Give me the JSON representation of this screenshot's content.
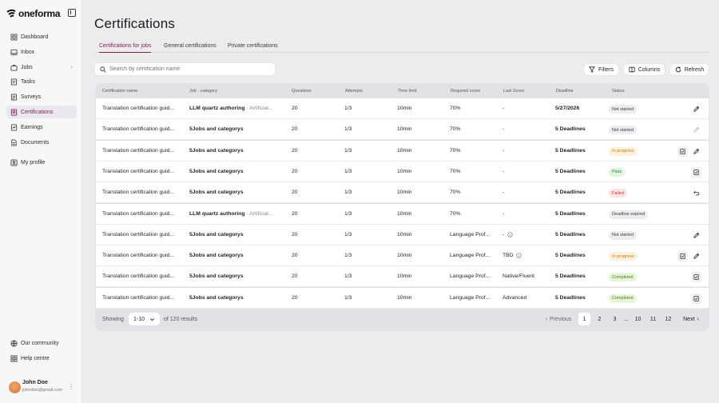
{
  "brand": {
    "name": "oneforma"
  },
  "sidebar": {
    "items": [
      {
        "label": "Dashboard",
        "icon": "grid-icon"
      },
      {
        "label": "Inbox",
        "icon": "inbox-icon"
      },
      {
        "label": "Jobs",
        "icon": "briefcase-icon"
      },
      {
        "label": "Tasks",
        "icon": "tasks-icon"
      },
      {
        "label": "Surveys",
        "icon": "survey-icon"
      },
      {
        "label": "Certifications",
        "icon": "certificate-icon",
        "active": true
      },
      {
        "label": "Earnings",
        "icon": "earnings-icon"
      },
      {
        "label": "Documents",
        "icon": "document-icon"
      },
      {
        "label": "My profile",
        "icon": "profile-icon"
      }
    ],
    "footer": [
      {
        "label": "Our community",
        "icon": "globe-icon"
      },
      {
        "label": "Help centre",
        "icon": "help-icon"
      }
    ],
    "user": {
      "name": "John Doe",
      "email": "johndoe@gmail.com"
    }
  },
  "page": {
    "title": "Certifications"
  },
  "tabs": [
    "Certifications for jobs",
    "General certifications",
    "Private certifications"
  ],
  "search": {
    "placeholder": "Search by certification name"
  },
  "toolbar": {
    "filters": "Filters",
    "columns": "Columns",
    "refresh": "Refresh"
  },
  "table": {
    "headers": [
      "Certification name",
      "Job · category",
      "Questions",
      "Attempts",
      "Time limit",
      "Required score",
      "Last Score",
      "Deadline",
      "Status"
    ],
    "rows": [
      {
        "name": "Translation certification guid...",
        "job": "LLM quartz authoring",
        "category": "· Artificial...",
        "questions": "20",
        "attempts": "1/3",
        "time": "10min",
        "required": "70%",
        "last": "-",
        "last_info": false,
        "deadline": "5/27/2026",
        "status": "Not started",
        "actions": [
          "edit"
        ]
      },
      {
        "name": "Translation certification guid...",
        "job": "5Jobs and categorys",
        "category": "",
        "questions": "20",
        "attempts": "1/3",
        "time": "10min",
        "required": "70%",
        "last": "-",
        "last_info": false,
        "deadline": "5 Deadlines",
        "status": "Not started",
        "actions": [
          "edit-disabled"
        ]
      },
      {
        "name": "Translation certification guid...",
        "job": "5Jobs and categorys",
        "category": "",
        "questions": "20",
        "attempts": "1/3",
        "time": "10min",
        "required": "70%",
        "last": "-",
        "last_info": false,
        "deadline": "5 Deadlines",
        "status": "In progress",
        "actions": [
          "review",
          "edit"
        ]
      },
      {
        "name": "Translation certification guid...",
        "job": "5Jobs and categorys",
        "category": "",
        "questions": "20",
        "attempts": "1/3",
        "time": "10min",
        "required": "70%",
        "last": "-",
        "last_info": false,
        "deadline": "5 Deadlines",
        "status": "Pass",
        "actions": [
          "review"
        ]
      },
      {
        "name": "Translation certification guid...",
        "job": "5Jobs and categorys",
        "category": "",
        "questions": "20",
        "attempts": "1/3",
        "time": "10min",
        "required": "70%",
        "last": "-",
        "last_info": false,
        "deadline": "5 Deadlines",
        "status": "Failed",
        "actions": [
          "retry"
        ]
      },
      {
        "name": "Translation certification guid...",
        "job": "LLM quartz authoring",
        "category": "· Artificial...",
        "questions": "20",
        "attempts": "1/3",
        "time": "10min",
        "required": "70%",
        "last": "-",
        "last_info": false,
        "deadline": "5 Deadlines",
        "status": "Deadline expired",
        "actions": []
      },
      {
        "name": "Translation certification guid...",
        "job": "5Jobs and categorys",
        "category": "",
        "questions": "20",
        "attempts": "1/3",
        "time": "10min",
        "required": "Language Prof...",
        "last": "-",
        "last_info": true,
        "deadline": "5 Deadlines",
        "status": "Not started",
        "actions": [
          "edit"
        ]
      },
      {
        "name": "Translation certification guid...",
        "job": "5Jobs and categorys",
        "category": "",
        "questions": "20",
        "attempts": "1/3",
        "time": "10min",
        "required": "Language Prof...",
        "last": "TBD",
        "last_info": true,
        "deadline": "5 Deadlines",
        "status": "In progress",
        "actions": [
          "review",
          "edit"
        ]
      },
      {
        "name": "Translation certification guid...",
        "job": "5Jobs and categorys",
        "category": "",
        "questions": "20",
        "attempts": "1/3",
        "time": "10min",
        "required": "Language Prof...",
        "last": "Native/Fluent",
        "last_info": false,
        "deadline": "5 Deadlines",
        "status": "Completed",
        "actions": [
          "review"
        ]
      },
      {
        "name": "Translation certification guid...",
        "job": "5Jobs and categorys",
        "category": "",
        "questions": "20",
        "attempts": "1/3",
        "time": "10min",
        "required": "Language Prof...",
        "last": "Advanced",
        "last_info": false,
        "deadline": "5 Deadlines",
        "status": "Completed",
        "actions": [
          "review"
        ]
      }
    ]
  },
  "status_colors": {
    "Not started": {
      "bg": "#ededf0",
      "fg": "#3a3a40"
    },
    "In progress": {
      "bg": "#fff1dc",
      "fg": "#c5781b"
    },
    "Pass": {
      "bg": "#e2f5e3",
      "fg": "#2f7d36"
    },
    "Failed": {
      "bg": "#fde3e2",
      "fg": "#c23b33"
    },
    "Deadline expired": {
      "bg": "#ededf0",
      "fg": "#3a3a40"
    },
    "Completed": {
      "bg": "#e8f5d9",
      "fg": "#4a7a1f"
    }
  },
  "footer": {
    "showing": "Showing",
    "page_size": "1-10",
    "results": "of 120 results",
    "previous": "Previous",
    "next": "Next",
    "pages": [
      "1",
      "2",
      "3",
      "...",
      "10",
      "11",
      "12"
    ],
    "current": "1"
  },
  "accent": "#7b2252"
}
